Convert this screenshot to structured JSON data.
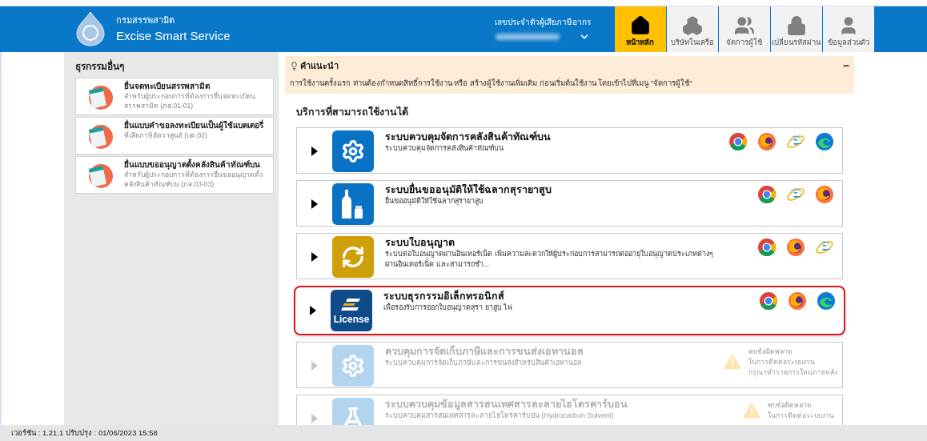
{
  "header": {
    "department": "กรมสรรพสามิต",
    "app_name": "Excise Smart Service",
    "taxpayer_label": "เลขประจำตัวผู้เสียภาษีอากร",
    "nav": [
      {
        "label": "หน้าหลัก",
        "kind": "home",
        "selected": true
      },
      {
        "label": "บริษัทในเครือ",
        "kind": "boxes",
        "selected": false
      },
      {
        "label": "จัดการผู้ใช้",
        "kind": "users",
        "selected": false
      },
      {
        "label": "เปลี่ยนรหัสผ่าน",
        "kind": "lock",
        "selected": false
      },
      {
        "label": "ข้อมูลส่วนตัว",
        "kind": "user",
        "selected": false
      }
    ]
  },
  "sidebar": {
    "title": "ธุรกรรมอื่นๆ",
    "items": [
      {
        "title": "ยื่นจดทะเบียนสรรพสามิต",
        "description": "สำหรับผู้ประกอบการที่ต้องการยื่นจดทะเบียนสรรพสามิต (ภส.01-01)"
      },
      {
        "title": "ยื่นแบบคำขอลงทะเบียนเป็นผู้ใช้แบตเตอรี่",
        "description": "ที่เสียภาษีอัตราศูนย์ (บต.02)"
      },
      {
        "title": "ยื่นแบบขออนุญาตตั้งคลังสินค้าทัณฑ์บน",
        "description": "สำหรับผู้ประกอบการที่ต้องการยื่นขออนุญาตตั้งคลังสินค้าทัณฑ์บน (ภส.03-03)"
      }
    ]
  },
  "advice": {
    "title": "คำแนะนำ",
    "collapse_symbol": "−",
    "text": "การใช้งานครั้งแรก ท่านต้องกำหนดสิทธิ์การใช้งาน หรือ สร้างผู้ใช้งานเพิ่มเติม ก่อนเริ่มต้นใช้งาน โดยเข้าไปที่เมนู \"จัดการผู้ใช้\""
  },
  "services": {
    "title": "บริการที่สามารถใช้งานได้",
    "items": [
      {
        "kind": "gear",
        "title": "ระบบควบคุมจัดการคลังสินค้าทัณฑ์บน",
        "description": "ระบบควบคุมจัดการคลังสินค้าทัณฑ์บน",
        "disabled": false,
        "highlighted": false,
        "browsers": [
          {
            "kind": "chrome"
          },
          {
            "kind": "firefox"
          },
          {
            "kind": "ie"
          },
          {
            "kind": "edge"
          }
        ]
      },
      {
        "kind": "bottle",
        "title": "ระบบยื่นขออนุมัติให้ใช้ฉลากสุรายาสูบ",
        "description": "ยื่นขออนุมัติให้ใช้ฉลากสุรายาสูบ",
        "disabled": false,
        "highlighted": false,
        "browsers": [
          {
            "kind": "chrome"
          },
          {
            "kind": "ie"
          },
          {
            "kind": "firefox"
          }
        ]
      },
      {
        "kind": "refresh",
        "title": "ระบบใบอนุญาต",
        "description": "ระบบต่อใบอนุญาตผ่านอินเทอร์เน็ต เพิ่มความสะดวกให้ผู้ประกอบการสามารถต่ออายุใบอนุญาตประเภทต่างๆ ผ่านอินเทอร์เน็ต และสามารถชำ...",
        "disabled": false,
        "highlighted": false,
        "browsers": [
          {
            "kind": "chrome"
          },
          {
            "kind": "firefox"
          },
          {
            "kind": "ie"
          }
        ]
      },
      {
        "kind": "license",
        "logo_text": "License",
        "title": "ระบบธุรกรรมอิเล็กทรอนิกส์",
        "description": "เพื่อรองรับการออกใบอนุญาตสุรา ยาสูบ ไพ่",
        "disabled": false,
        "highlighted": true,
        "browsers": [
          {
            "kind": "chrome"
          },
          {
            "kind": "firefox"
          },
          {
            "kind": "edge"
          }
        ]
      },
      {
        "kind": "gear",
        "title": "ควบคุมการจัดเก็บภาษีและการขนส่งเอทานอล",
        "description": "ระบบควบคุมการจัดเก็บภาษีและการขนส่งสำหรับสินค้าเอทานอล",
        "disabled": true,
        "highlighted": false,
        "error": [
          "พบข้อผิดพลาด",
          "ในการติดต่อระบบงาน",
          "กรุณาทำรายการใหม่ภายหลัง"
        ]
      },
      {
        "kind": "flask",
        "title": "ระบบควบคุมข้อมูลสารสนเทศสารละลายไฮโดรคาร์บอน",
        "description": "ระบบควบคุมสารสนเทศสารละลายไฮโดรคาร์บอน (Hydrocarbon Solvent)",
        "disabled": true,
        "highlighted": false,
        "error": [
          "พบข้อผิดพลาด",
          "ในการติดต่อระบบงาน"
        ]
      }
    ]
  },
  "footer": {
    "version": "เวอร์ชัน : 1.21.1 ปรับปรุง : 01/06/2023 15:58"
  }
}
